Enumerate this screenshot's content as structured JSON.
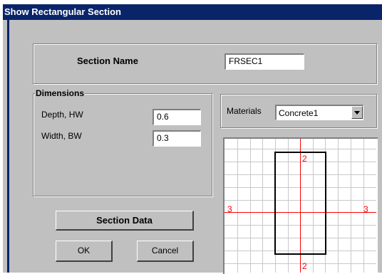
{
  "window": {
    "title": "Show Rectangular Section"
  },
  "section_name": {
    "label": "Section Name",
    "value": "FRSEC1"
  },
  "dimensions": {
    "legend": "Dimensions",
    "depth_label": "Depth, HW",
    "depth_value": "0.6",
    "width_label": "Width, BW",
    "width_value": "0.3"
  },
  "materials": {
    "label": "Materials",
    "selected": "Concrete1"
  },
  "preview": {
    "axis_2_top": "2",
    "axis_2_bottom": "2",
    "axis_3_left": "3",
    "axis_3_right": "3"
  },
  "buttons": {
    "section_data": "Section Data",
    "ok": "OK",
    "cancel": "Cancel"
  },
  "colors": {
    "titlebar": "#0a246a",
    "dialog": "#c0c0c0",
    "grid": "#c8c8c8",
    "axis": "#ff0000",
    "section": "#000000"
  }
}
